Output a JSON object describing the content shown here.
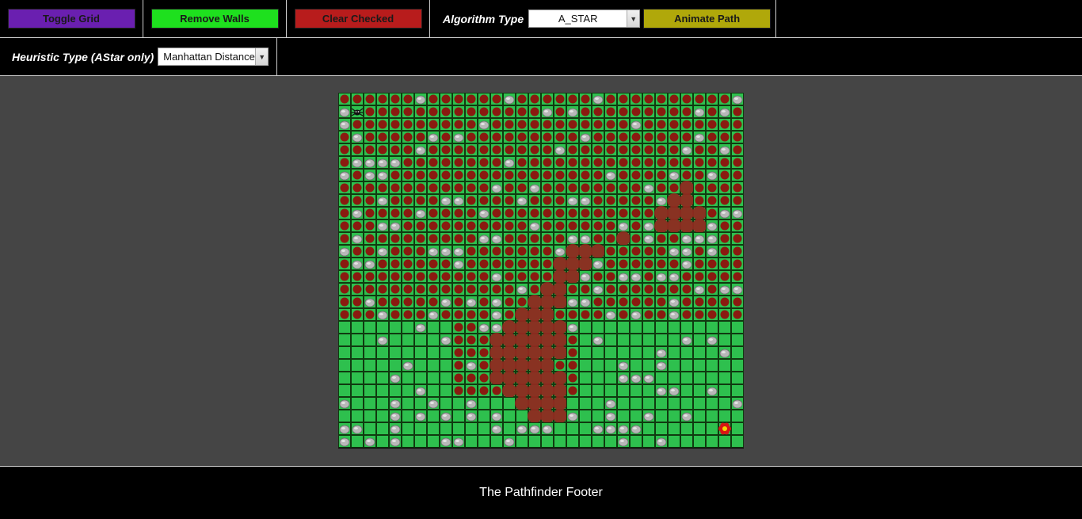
{
  "toolbar": {
    "toggle_grid": "Toggle Grid",
    "remove_walls": "Remove Walls",
    "clear_checked": "Clear Checked",
    "algorithm_label": "Algorithm Type",
    "algorithm_value": "A_STAR",
    "animate_path": "Animate Path",
    "heuristic_label": "Heuristic Type (AStar only)",
    "heuristic_value": "Manhattan Distance"
  },
  "colors": {
    "toggle_grid": "#6a1fb0",
    "remove_walls": "#1ee01e",
    "clear_checked": "#b81c1c",
    "animate_path": "#b0a80a",
    "grass": "#2ec04e",
    "visited": "#8a1a10",
    "path": "#8e2a20",
    "rock": "#b8b8b8"
  },
  "icons": {
    "start": "spider-icon",
    "goal": "flower-icon",
    "wall": "rock-icon",
    "visited": "visited-dot-icon"
  },
  "footer": {
    "text": "The Pathfinder Footer"
  }
}
